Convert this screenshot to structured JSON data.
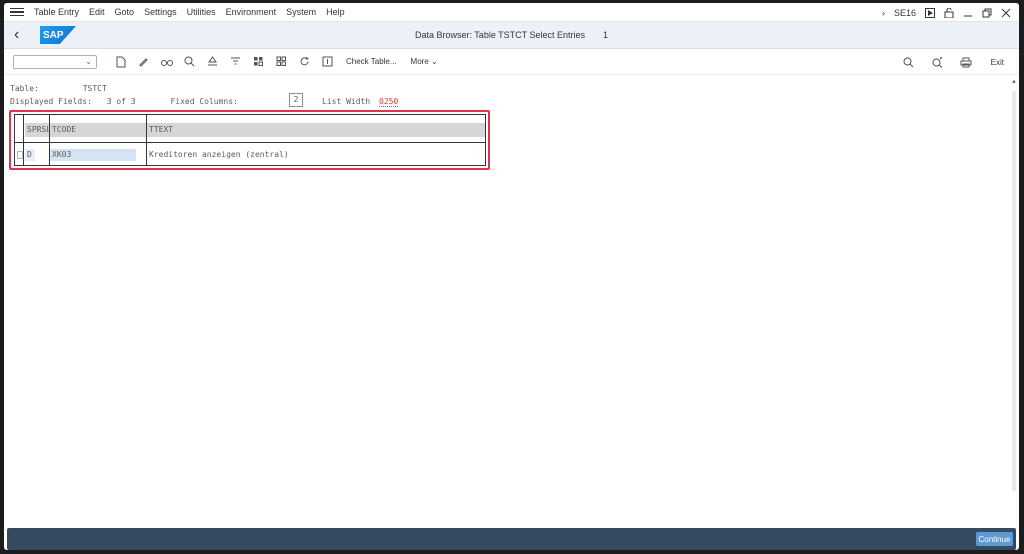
{
  "menubar": {
    "items": [
      "Table Entry",
      "Edit",
      "Goto",
      "Settings",
      "Utilities",
      "Environment",
      "System",
      "Help"
    ],
    "transaction": "SE16"
  },
  "titlebar": {
    "title": "Data Browser: Table TSTCT Select Entries",
    "count": "1",
    "logo_text": "SAP"
  },
  "toolbar": {
    "check_table": "Check Table...",
    "more": "More",
    "exit": "Exit"
  },
  "header_info": {
    "table_label": "Table:",
    "table_value": "TSTCT",
    "displayed_fields_label": "Displayed Fields:",
    "displayed_fields_value": "3 of  3",
    "fixed_columns_label": "Fixed Columns:",
    "fixed_columns_value": "2",
    "list_width_label": "List Width",
    "list_width_value": "0250"
  },
  "grid": {
    "columns": [
      "SPRSL",
      "TCODE",
      "TTEXT"
    ],
    "rows": [
      {
        "sprsl": "D",
        "tcode": "XK03",
        "ttext": "Kreditoren anzeigen (zentral)"
      }
    ]
  },
  "footer": {
    "continue": "Continue"
  },
  "colors": {
    "accent": "#0a6ed1",
    "highlight": "#e0334c",
    "footer_bg": "#354a5f",
    "button_bg": "#5d9ad3"
  }
}
